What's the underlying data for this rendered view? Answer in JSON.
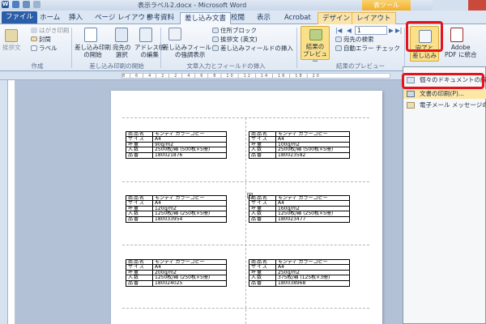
{
  "window": {
    "title": "表示ラベル2.docx - Microsoft Word",
    "context_title": "表ツール"
  },
  "tabs": {
    "file": "ファイル",
    "home": "ホーム",
    "insert": "挿入",
    "page_layout": "ページ レイアウト",
    "references": "参考資料",
    "mailings": "差し込み文書",
    "review": "校閲",
    "view": "表示",
    "acrobat": "Acrobat",
    "design": "デザイン",
    "layout": "レイアウト"
  },
  "ribbon": {
    "create": {
      "envelope_label": "封筒",
      "labels_label": "ラベル",
      "japanese_envelope": "挨拶文",
      "postcard": "はがき印刷",
      "group_name": "作成"
    },
    "start_merge": {
      "start_label_1": "差し込み印刷",
      "start_label_2": "の開始",
      "recipients_1": "宛先の",
      "recipients_2": "選択",
      "edit_list_1": "アドレス帳",
      "edit_list_2": "の編集",
      "group_name": "差し込み印刷の開始"
    },
    "write_insert": {
      "highlight_1": "差し込みフィールド",
      "highlight_2": "の強調表示",
      "address_block": "住所ブロック",
      "greeting_line": "挨拶文 (英文)",
      "insert_field": "差し込みフィールドの挿入",
      "group_name": "文章入力とフィールドの挿入"
    },
    "preview": {
      "preview_1": "結果の",
      "preview_2": "プレビュー",
      "record_number": "1",
      "find_recipient": "宛先の検索",
      "auto_check": "自動エラー チェック",
      "group_name": "結果のプレビュー"
    },
    "finish": {
      "finish_1": "完了と",
      "finish_2": "差し込み"
    },
    "acrobat": {
      "label_1": "Adobe",
      "label_2": "PDF に統合"
    }
  },
  "dropdown": {
    "items": [
      "個々のドキュメントの編集(E)...",
      "文書の印刷(P)...",
      "電子メール メッセージの送信(S)..."
    ]
  },
  "labels": [
    {
      "rows": [
        [
          "商品名",
          "モンディ カラーコピー"
        ],
        [
          "サイズ",
          "A4"
        ],
        [
          "坪量",
          "90g/m2"
        ],
        [
          "入数",
          "2500枚/箱 (500枚×5冊)"
        ],
        [
          "品番",
          "180021876"
        ]
      ]
    },
    {
      "rows": [
        [
          "商品名",
          "モンディ カラーコピー"
        ],
        [
          "サイズ",
          "A4"
        ],
        [
          "坪量",
          "100g/m2"
        ],
        [
          "入数",
          "2500枚/箱 (500枚×5冊)"
        ],
        [
          "品番",
          "180023582"
        ]
      ]
    },
    {
      "rows": [
        [
          "商品名",
          "モンディ カラーコピー"
        ],
        [
          "サイズ",
          "A4"
        ],
        [
          "坪量",
          "120g/m2"
        ],
        [
          "入数",
          "1250枚/箱 (250枚×5冊)"
        ],
        [
          "品番",
          "180033954"
        ]
      ]
    },
    {
      "rows": [
        [
          "商品名",
          "モンディ カラーコピー"
        ],
        [
          "サイズ",
          "A4"
        ],
        [
          "坪量",
          "160g/m2"
        ],
        [
          "入数",
          "1250枚/箱 (250枚×5冊)"
        ],
        [
          "品番",
          "180023477"
        ]
      ]
    },
    {
      "rows": [
        [
          "商品名",
          "モンディ カラーコピー"
        ],
        [
          "サイズ",
          "A4"
        ],
        [
          "坪量",
          "200g/m2"
        ],
        [
          "入数",
          "1250枚/箱 (250枚×5冊)"
        ],
        [
          "品番",
          "180024025"
        ]
      ]
    },
    {
      "rows": [
        [
          "商品名",
          "モンディ カラーコピー"
        ],
        [
          "サイズ",
          "A4"
        ],
        [
          "坪量",
          "250g/m2"
        ],
        [
          "入数",
          "375枚/箱 (125枚×3冊)"
        ],
        [
          "品番",
          "180038968"
        ]
      ]
    }
  ],
  "ruler_text": "8 | 6 | 4 | 2 | 2 | 4 | 6 | 8 | 10 | 12 | 14 | 16 | 18 | 20",
  "colors": {
    "highlight_red": "#e3141b",
    "file_tab": "#2b5ea8",
    "context_tab": "#f2ae2a"
  }
}
